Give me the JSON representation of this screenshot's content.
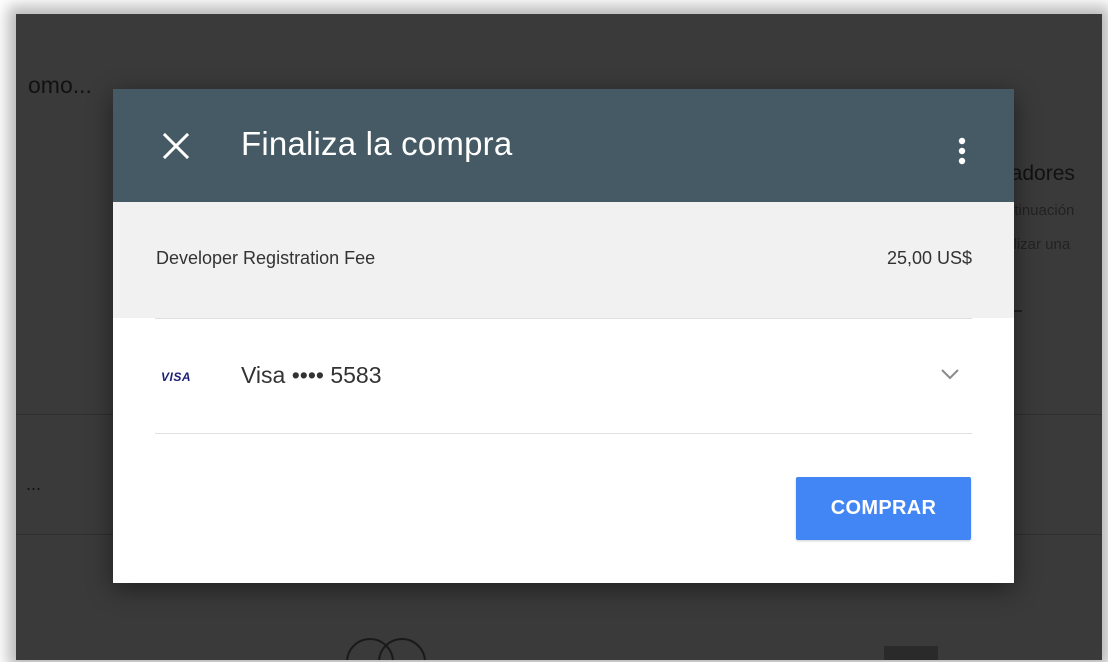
{
  "background": {
    "title_fragment": "omo...",
    "right_title_fragment": "ladores",
    "right_line_1": "ntinuación",
    "right_line_2": "tilizar una",
    "ellipsis": "..."
  },
  "dialog": {
    "title": "Finaliza la compra",
    "close_icon": "close-icon",
    "more_icon": "more-vert-icon",
    "header_color": "#455a64"
  },
  "order": {
    "item_label": "Developer Registration Fee",
    "amount": "25,00 US$"
  },
  "payment": {
    "card_brand": "VISA",
    "card_label": "Visa •••• 5583",
    "chevron_icon": "chevron-down-icon"
  },
  "actions": {
    "buy_label": "COMPRAR",
    "buy_color": "#4285f4"
  }
}
